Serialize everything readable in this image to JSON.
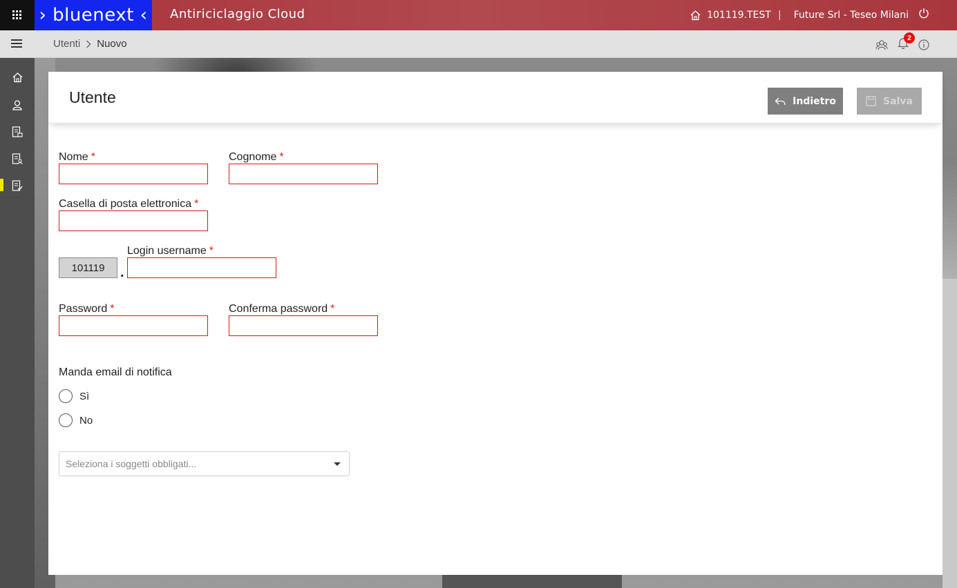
{
  "topbar": {
    "brand": "› bluenext ‹",
    "app_title": "Antiriciclaggio Cloud",
    "tenant": "101119.TEST",
    "user": "Future Srl - Teseo Milani",
    "brand_color": "#1326f0",
    "bar_color": "#a8323a"
  },
  "breadcrumb": {
    "parent": "Utenti",
    "current": "Nuovo"
  },
  "notifications": {
    "count": "2"
  },
  "sidebar": {
    "items": [
      {
        "icon": "home-icon"
      },
      {
        "icon": "user-icon"
      },
      {
        "icon": "document-edit-icon"
      },
      {
        "icon": "document-user-icon"
      },
      {
        "icon": "document-check-icon",
        "active": true
      }
    ]
  },
  "form": {
    "title": "Utente",
    "back_label": "Indietro",
    "save_label": "Salva",
    "nome_label": "Nome",
    "cognome_label": "Cognome",
    "email_label": "Casella di posta elettronica",
    "login_prefix": "101119",
    "login_sep": ".",
    "login_label": "Login username",
    "password_label": "Password",
    "confirm_password_label": "Conferma password",
    "required_mark": "*",
    "notify_label": "Manda email di notifica",
    "notify_yes": "Sì",
    "notify_no": "No",
    "select_placeholder": "Seleziona i soggetti obbligati...",
    "nome_value": "",
    "cognome_value": "",
    "email_value": "",
    "login_value": "",
    "password_value": "",
    "confirm_password_value": ""
  }
}
